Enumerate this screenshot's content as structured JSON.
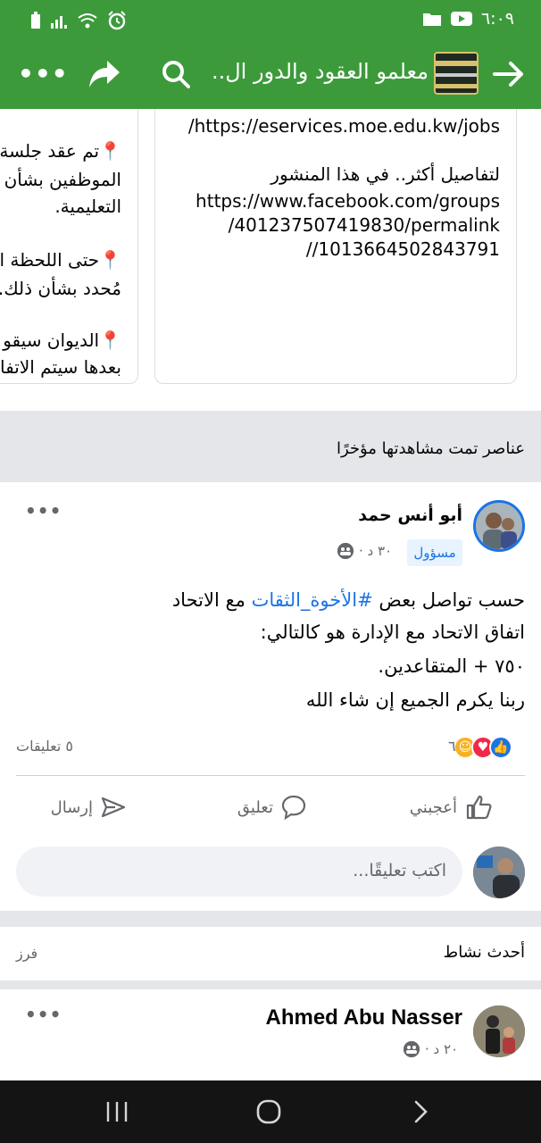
{
  "status_bar": {
    "time": "٦:٠٩",
    "left_icons": [
      "battery-icon",
      "signal-icon",
      "wifi-icon",
      "alarm-icon"
    ],
    "right_icons": [
      "youtube-icon",
      "folder-icon"
    ]
  },
  "app_bar": {
    "title": "معلمو العقود والدور ال...",
    "icons": [
      "back-arrow-icon",
      "group-thumbnail",
      "search-icon",
      "share-icon",
      "more-icon"
    ]
  },
  "top_cards": {
    "right_card_lines": [
      "/https://eservices.moe.edu.kw/jobs",
      "لتفاصيل أكثر.. في هذا المنشور",
      "https://www.facebook.com/groups",
      "/401237507419830/permalink",
      "//1013664502843791"
    ],
    "left_card_lines": [
      "📍تم عقد جلسة",
      "الموظفين بشأن م",
      "التعليمية.",
      "📍حتى اللحظة ا",
      "مُحدد بشأن ذلك.",
      "📍الديوان سيقو",
      "بعدها سيتم الاتفا"
    ]
  },
  "recent": {
    "title": "عناصر تمت مشاهدتها مؤخرًا"
  },
  "post": {
    "author": "أبو أنس حمد",
    "badge": "مسؤول",
    "time": "٣٠ د ·",
    "privacy_icon": "group-icon",
    "text_line1_before": "حسب تواصل بعض ",
    "hashtag": "#الأخوة_الثقات",
    "text_line1_after": " مع الاتحاد",
    "text_line2": "اتفاق الاتحاد مع الإدارة هو كالتالي:",
    "text_line3": "٧٥٠ + المتقاعدين.",
    "text_line4": "ربنا يكرم الجميع إن شاء الله",
    "reaction_icons": [
      "like-reaction-icon",
      "love-reaction-icon",
      "care-reaction-icon"
    ],
    "reaction_count": "٦",
    "comments_count": "٥ تعليقات",
    "actions": {
      "like": "أعجبني",
      "comment": "تعليق",
      "send": "إرسال"
    },
    "comment_placeholder": "اكتب تعليقًا..."
  },
  "activity": {
    "title": "أحدث نشاط",
    "sort": "فرز"
  },
  "post2": {
    "author": "Ahmed Abu Nasser",
    "time": "٢٠ د ·"
  },
  "nav_bar": {
    "icons": [
      "recent-apps-icon",
      "home-icon",
      "back-icon"
    ]
  },
  "colors": {
    "app_green": "#3c9a3b",
    "facebook_blue": "#1b74e4",
    "gray_band": "#e4e6e9",
    "secondary_text": "#65676b"
  }
}
